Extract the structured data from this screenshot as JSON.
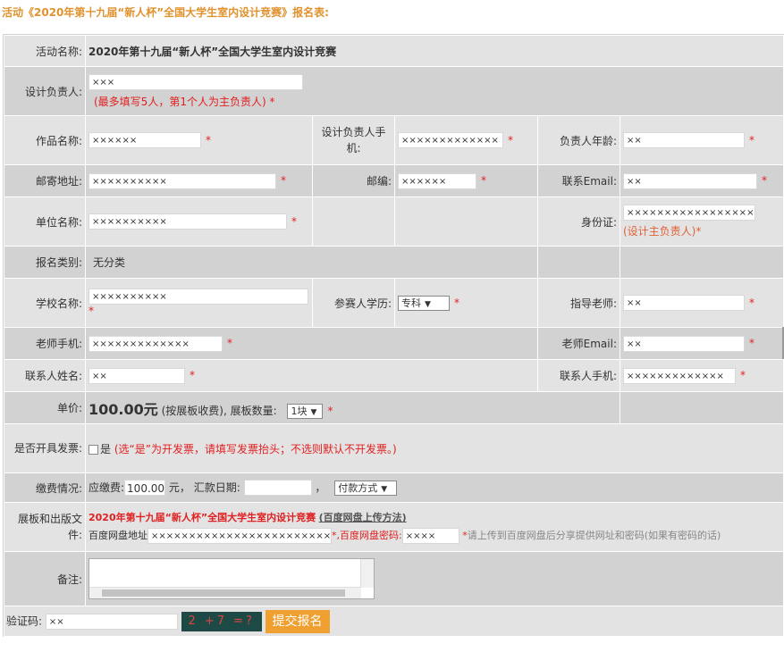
{
  "page_title": "活动《2020年第十九届“新人杯”全国大学生室内设计竞赛》报名表:",
  "rows": {
    "activity": {
      "label": "活动名称:",
      "value": "2020年第十九届“新人杯”全国大学生室内设计竞赛"
    },
    "leader": {
      "label": "设计负责人:",
      "value": "×××",
      "note": "(最多填写5人，第1个人为主负责人)",
      "req": "*"
    },
    "work": {
      "label": "作品名称:",
      "value": "××××××",
      "req": "*",
      "phone_label": "设计负责人手机:",
      "phone_value": "×××××××××××××",
      "phone_req": "*",
      "age_label": "负责人年龄:",
      "age_value": "××",
      "age_req": "*"
    },
    "address": {
      "label": "邮寄地址:",
      "value": "××××××××××",
      "req": "*",
      "zip_label": "邮编:",
      "zip_value": "××××××",
      "zip_req": "*",
      "email_label": "联系Email:",
      "email_value": "××",
      "email_req": "*"
    },
    "unit": {
      "label": "单位名称:",
      "value": "××××××××××",
      "req": "*",
      "id_label": "身份证:",
      "id_value": "××××××××××××××××××",
      "id_note": "(设计主负责人)*"
    },
    "category": {
      "label": "报名类别:",
      "value": "无分类"
    },
    "school": {
      "label": "学校名称:",
      "value": "××××××××××",
      "req": "*",
      "edu_label": "参赛人学历:",
      "edu_value": "专科",
      "edu_req": "*",
      "tutor_label": "指导老师:",
      "tutor_value": "××",
      "tutor_req": "*"
    },
    "teacher_phone": {
      "label": "老师手机:",
      "value": "×××××××××××××",
      "req": "*",
      "temail_label": "老师Email:",
      "temail_value": "××",
      "temail_req": "*"
    },
    "contact": {
      "label": "联系人姓名:",
      "value": "××",
      "req": "*",
      "cphone_label": "联系人手机:",
      "cphone_value": "×××××××××××××",
      "cphone_req": "*"
    },
    "price": {
      "label": "单价:",
      "amount": "100.00元",
      "unit_note": "(按展板收费),",
      "count_label": "展板数量:",
      "count_value": "1块",
      "req": "*"
    },
    "invoice": {
      "label": "是否开具发票:",
      "check_label": "是",
      "note": "(选“是”为开发票，请填写发票抬头；不选则默认不开发票。)"
    },
    "payment": {
      "label": "缴费情况:",
      "due_label": "应缴费:",
      "due_value": "100.00",
      "yuan": "元，",
      "date_label": "汇款日期:",
      "date_value": "",
      "comma": "，",
      "method_value": "付款方式"
    },
    "upload": {
      "label": "展板和出版文件:",
      "title_red": "2020年第十九届“新人杯”全国大学生室内设计竞赛",
      "title_link": "(百度网盘上传方法)",
      "url_label": "百度网盘地址",
      "url_value": "×××××××××××××××××××××××××××",
      "pwd_label": "*,百度网盘密码:",
      "pwd_value": "××××",
      "note_req": "*",
      "note": "请上传到百度网盘后分享提供网址和密码(如果有密码的话)"
    },
    "remarks": {
      "label": "备注:",
      "value": ""
    },
    "captcha": {
      "label": "验证码:",
      "value": "××",
      "captcha_text": "2 +7 =?",
      "submit": "提交报名"
    }
  }
}
